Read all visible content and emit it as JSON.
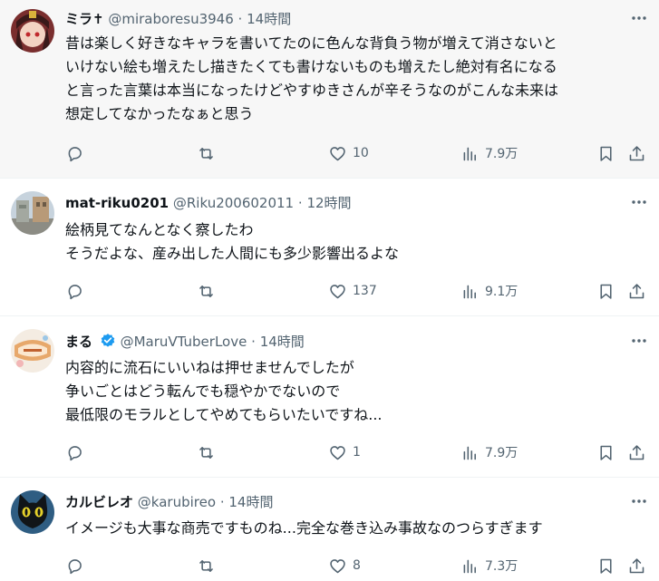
{
  "tweets": [
    {
      "name": "ミラ✝",
      "handle": "@miraboresu3946",
      "sep": "·",
      "time": "14時間",
      "verified": false,
      "lines": [
        "昔は楽しく好きなキャラを書いてたのに色んな背負う物が増えて消さないと",
        "いけない絵も増えたし描きたくても書けないものも増えたし絶対有名になる",
        "と言った言葉は本当になったけどやすゆきさんが辛そうなのがこんな未来は",
        "想定してなかったなぁと思う"
      ],
      "replies": "",
      "retweets": "",
      "likes": "10",
      "views": "7.9万",
      "avatar_icon": "anime-girl-avatar",
      "highlight_color": "#f7f7f7"
    },
    {
      "name": "mat-riku0201",
      "handle": "@Riku200602011",
      "sep": "·",
      "time": "12時間",
      "verified": false,
      "lines": [
        "絵柄見てなんとなく察したわ",
        "そうだよな、産み出した人間にも多少影響出るよな"
      ],
      "replies": "",
      "retweets": "",
      "likes": "137",
      "views": "9.1万",
      "avatar_icon": "street-photo-avatar"
    },
    {
      "name": "まる",
      "handle": "@MaruVTuberLove",
      "sep": "·",
      "time": "14時間",
      "verified": true,
      "lines": [
        "内容的に流石にいいねは押せませんでしたが",
        "争いごとはどう転んでも穏やかでないので",
        "最低限のモラルとしてやめてもらいたいですね..."
      ],
      "replies": "",
      "retweets": "",
      "likes": "1",
      "views": "7.9万",
      "avatar_icon": "vtuber-logo-avatar"
    },
    {
      "name": "カルビレオ",
      "handle": "@karubireo",
      "sep": "·",
      "time": "14時間",
      "verified": false,
      "lines": [
        "イメージも大事な商売ですものね...完全な巻き込み事故なのつらすぎます"
      ],
      "replies": "",
      "retweets": "",
      "likes": "8",
      "views": "7.3万",
      "avatar_icon": "black-cat-avatar"
    }
  ],
  "colors": {
    "text": "#0f1419",
    "secondary": "#536471",
    "border": "#eff3f4",
    "verified": "#1d9bf0"
  }
}
